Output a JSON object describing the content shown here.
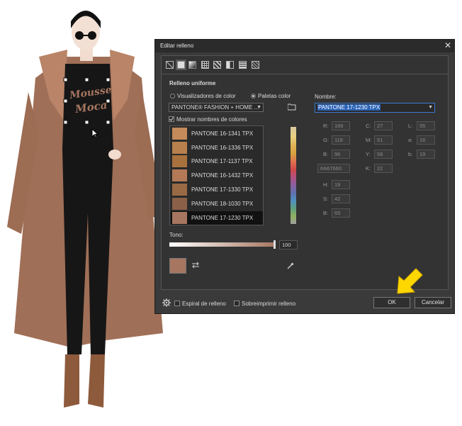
{
  "dialog": {
    "title": "Editar relleno",
    "close_glyph": "✕",
    "section_title": "Relleno uniforme",
    "radio_viewers": "Visualizadores de color",
    "radio_palettes": "Paletas color",
    "palette_select": "PANTONE® FASHION + HOME ...",
    "show_names": "Mostrar nombres de colores",
    "name_label": "Nombre:",
    "name_value": "PANTONE 17-1230 TPX",
    "tone_label": "Tono:",
    "tone_value": "100",
    "spiral_label": "Espiral de relleno",
    "overprint_label": "Sobreimprimir relleno",
    "ok_label": "OK",
    "cancel_label": "Cancelar"
  },
  "swatches": [
    {
      "name": "PANTONE 16-1341 TPX",
      "color": "#c48a5a"
    },
    {
      "name": "PANTONE 16-1336 TPX",
      "color": "#b8804c"
    },
    {
      "name": "PANTONE 17-1137 TPX",
      "color": "#a8713e"
    },
    {
      "name": "PANTONE 16-1432 TPX",
      "color": "#b47a58"
    },
    {
      "name": "PANTONE 17-1330 TPX",
      "color": "#9a6a44"
    },
    {
      "name": "PANTONE 18-1030 TPX",
      "color": "#8a6048"
    },
    {
      "name": "PANTONE 17-1230 TPX",
      "color": "#a67660"
    }
  ],
  "values": {
    "R": "166",
    "G": "118",
    "B": "96",
    "C": "27",
    "M": "51",
    "Y": "58",
    "K": "22",
    "L": "55",
    "a": "16",
    "b": "19",
    "hex": "#A67660",
    "H": "19",
    "S": "42",
    "Bv": "65"
  },
  "colors": {
    "selected": "#a67660",
    "coat": "#a67660",
    "accent_arrow": "#ffd700"
  },
  "illustration": {
    "logo_line1": "Mousse",
    "logo_line2": "Moca"
  }
}
